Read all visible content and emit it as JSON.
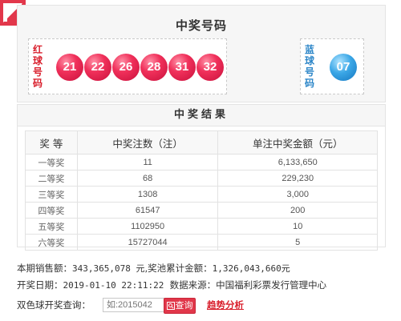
{
  "winning_numbers": {
    "title": "中奖号码",
    "red_label": [
      "红",
      "球",
      "号",
      "码"
    ],
    "blue_label": [
      "蓝",
      "球",
      "号",
      "码"
    ],
    "red_balls": [
      "21",
      "22",
      "26",
      "28",
      "31",
      "32"
    ],
    "blue_balls": [
      "07"
    ],
    "colors": {
      "red_ball": "#e8254e",
      "blue_ball": "#2f98dd",
      "red_text": "#d9202d",
      "blue_text": "#2c86c8"
    }
  },
  "results": {
    "title": "中奖结果",
    "headers": [
      "奖 等",
      "中奖注数（注）",
      "单注中奖金额（元）"
    ],
    "rows": [
      {
        "level": "一等奖",
        "count": "11",
        "amount": "6,133,650"
      },
      {
        "level": "二等奖",
        "count": "68",
        "amount": "229,230"
      },
      {
        "level": "三等奖",
        "count": "1308",
        "amount": "3,000"
      },
      {
        "level": "四等奖",
        "count": "61547",
        "amount": "200"
      },
      {
        "level": "五等奖",
        "count": "1102950",
        "amount": "10"
      },
      {
        "level": "六等奖",
        "count": "15727044",
        "amount": "5"
      }
    ]
  },
  "info": {
    "sales_label": "本期销售额：",
    "sales_value": "343,365,078 元",
    "pool_label": ",奖池累计金额：",
    "pool_value": "1,326,043,660元",
    "date_label": "开奖日期：",
    "date_value": "2019-01-10 22:11:22",
    "source_label": "数据来源：",
    "source_value": "中国福利彩票发行管理中心"
  },
  "search": {
    "label": "双色球开奖查询：",
    "placeholder": "如:2015042",
    "button_label": "查询",
    "trend_link": "趋势分析"
  }
}
